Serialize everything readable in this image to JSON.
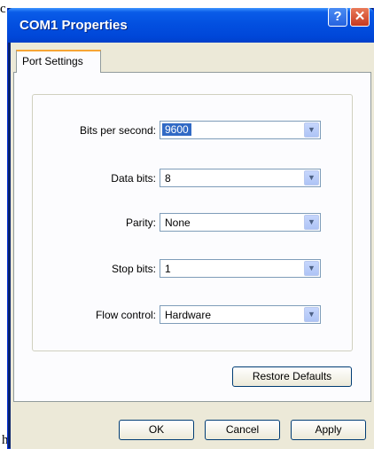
{
  "background": {
    "fragment_top": "c",
    "fragment_bottom": "h"
  },
  "window": {
    "title": "COM1 Properties",
    "help_glyph": "?",
    "close_glyph": "✕"
  },
  "tabs": [
    {
      "label": "Port Settings"
    }
  ],
  "fields": [
    {
      "label": "Bits per second:",
      "value": "9600"
    },
    {
      "label": "Data bits:",
      "value": "8"
    },
    {
      "label": "Parity:",
      "value": "None"
    },
    {
      "label": "Stop bits:",
      "value": "1"
    },
    {
      "label": "Flow control:",
      "value": "Hardware"
    }
  ],
  "buttons": {
    "restore": "Restore Defaults",
    "ok": "OK",
    "cancel": "Cancel",
    "apply": "Apply"
  },
  "colors": {
    "title_bar": "#0350e0",
    "selection": "#316ac5",
    "dialog_bg": "#ece9d8"
  }
}
